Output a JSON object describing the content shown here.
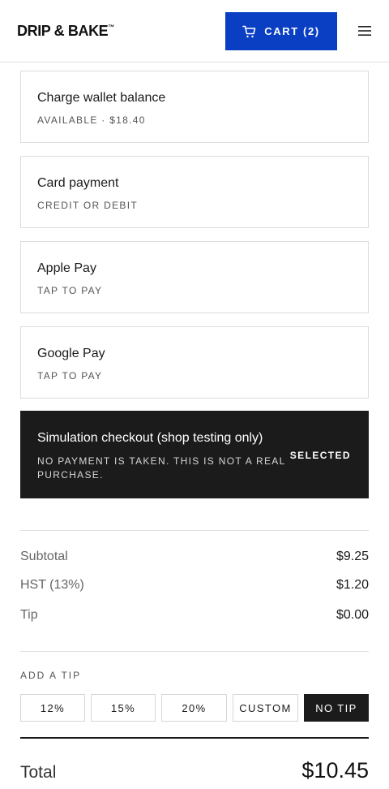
{
  "header": {
    "logo_text": "DRIP & BAKE",
    "logo_tm": "™",
    "cart_label": "CART (2)",
    "accent_color": "#0a3fc4"
  },
  "payment_options": [
    {
      "title": "Charge wallet balance",
      "subtitle": "AVAILABLE · $18.40"
    },
    {
      "title": "Card payment",
      "subtitle": "CREDIT OR DEBIT"
    },
    {
      "title": "Apple Pay",
      "subtitle": "TAP TO PAY"
    },
    {
      "title": "Google Pay",
      "subtitle": "TAP TO PAY"
    },
    {
      "title": "Simulation checkout (shop testing only)",
      "subtitle": "NO PAYMENT IS TAKEN. THIS IS NOT A REAL PURCHASE.",
      "badge": "SELECTED",
      "selected": true
    }
  ],
  "summary": {
    "subtotal_label": "Subtotal",
    "subtotal_value": "$9.25",
    "tax_label": "HST (13%)",
    "tax_value": "$1.20",
    "tip_label": "Tip",
    "tip_value": "$0.00"
  },
  "tip": {
    "heading": "ADD A TIP",
    "options": [
      "12%",
      "15%",
      "20%",
      "CUSTOM",
      "NO TIP"
    ],
    "selected": "NO TIP"
  },
  "total": {
    "label": "Total",
    "value": "$10.45"
  },
  "icons": {
    "cart": "cart-icon",
    "menu": "hamburger-menu-icon"
  }
}
